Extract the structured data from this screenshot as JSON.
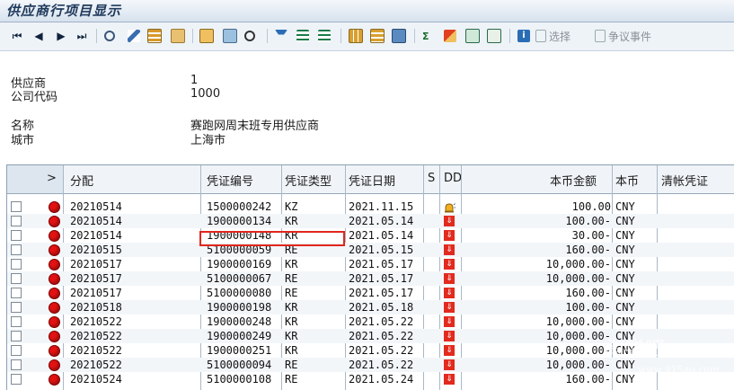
{
  "window": {
    "title": "供应商行项目显示"
  },
  "toolbar": {
    "select_label": "选择",
    "dispute_label": "争议事件"
  },
  "header": {
    "vendor_label": "供应商",
    "vendor_value": "1",
    "company_label": "公司代码",
    "company_value": "1000",
    "name_label": "名称",
    "name_value": "赛跑网周末班专用供应商",
    "city_label": "城市",
    "city_value": "上海市"
  },
  "table": {
    "columns": [
      "分配",
      "凭证编号",
      "凭证类型",
      "凭证日期",
      "S",
      "DD",
      "本币金额",
      "本币",
      "清帐凭证"
    ],
    "expand_symbol": ">",
    "rows": [
      {
        "assign": "20210514",
        "doc": "1500000242",
        "type": "KZ",
        "date": "2021.11.15",
        "dd": "bell",
        "amount": "100.00",
        "cur": "CNY"
      },
      {
        "assign": "20210514",
        "doc": "1900000134",
        "type": "KR",
        "date": "2021.05.14",
        "dd": "red",
        "amount": "100.00-",
        "cur": "CNY"
      },
      {
        "assign": "20210514",
        "doc": "1900000148",
        "type": "KR",
        "date": "2021.05.14",
        "dd": "red",
        "amount": "30.00-",
        "cur": "CNY"
      },
      {
        "assign": "20210515",
        "doc": "5100000059",
        "type": "RE",
        "date": "2021.05.15",
        "dd": "red",
        "amount": "160.00-",
        "cur": "CNY"
      },
      {
        "assign": "20210517",
        "doc": "1900000169",
        "type": "KR",
        "date": "2021.05.17",
        "dd": "red",
        "amount": "10,000.00-",
        "cur": "CNY"
      },
      {
        "assign": "20210517",
        "doc": "5100000067",
        "type": "RE",
        "date": "2021.05.17",
        "dd": "red",
        "amount": "10,000.00-",
        "cur": "CNY"
      },
      {
        "assign": "20210517",
        "doc": "5100000080",
        "type": "RE",
        "date": "2021.05.17",
        "dd": "red",
        "amount": "160.00-",
        "cur": "CNY"
      },
      {
        "assign": "20210518",
        "doc": "1900000198",
        "type": "KR",
        "date": "2021.05.18",
        "dd": "red",
        "amount": "100.00-",
        "cur": "CNY"
      },
      {
        "assign": "20210522",
        "doc": "1900000248",
        "type": "KR",
        "date": "2021.05.22",
        "dd": "red",
        "amount": "10,000.00-",
        "cur": "CNY"
      },
      {
        "assign": "20210522",
        "doc": "1900000249",
        "type": "KR",
        "date": "2021.05.22",
        "dd": "red",
        "amount": "10,000.00-",
        "cur": "CNY"
      },
      {
        "assign": "20210522",
        "doc": "1900000251",
        "type": "KR",
        "date": "2021.05.22",
        "dd": "red",
        "amount": "10,000.00-",
        "cur": "CNY"
      },
      {
        "assign": "20210522",
        "doc": "5100000094",
        "type": "RE",
        "date": "2021.05.22",
        "dd": "red",
        "amount": "10,000.00-",
        "cur": "CNY"
      },
      {
        "assign": "20210524",
        "doc": "5100000108",
        "type": "RE",
        "date": "2021.05.24",
        "dd": "red",
        "amount": "160.00-",
        "cur": "CNY"
      }
    ]
  },
  "watermark": {
    "text": "淘学吧",
    "url": "www.915ao.com"
  },
  "colors": {
    "highlight": "#e0261c",
    "status_red": "#e21212",
    "header_bg": "#f0f4f8"
  }
}
